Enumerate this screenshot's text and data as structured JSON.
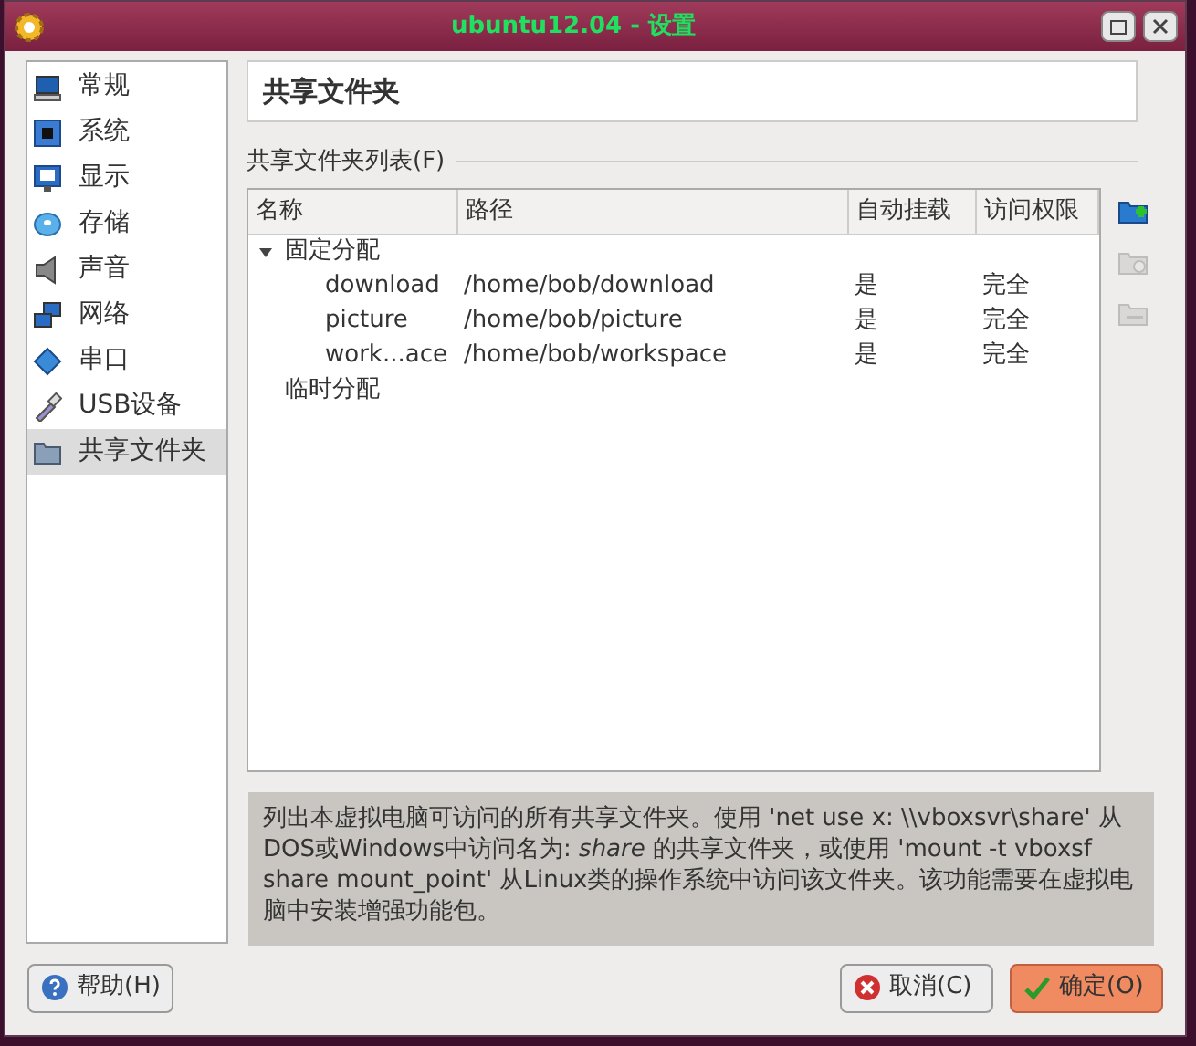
{
  "window": {
    "title": "ubuntu12.04 - 设置"
  },
  "sidebar": {
    "items": [
      {
        "label": "常规",
        "kind": "general",
        "selected": false
      },
      {
        "label": "系统",
        "kind": "system",
        "selected": false
      },
      {
        "label": "显示",
        "kind": "display",
        "selected": false
      },
      {
        "label": "存储",
        "kind": "storage",
        "selected": false
      },
      {
        "label": "声音",
        "kind": "audio",
        "selected": false
      },
      {
        "label": "网络",
        "kind": "network",
        "selected": false
      },
      {
        "label": "串口",
        "kind": "serial",
        "selected": false
      },
      {
        "label": "USB设备",
        "kind": "usb",
        "selected": false
      },
      {
        "label": "共享文件夹",
        "kind": "shared",
        "selected": true
      }
    ]
  },
  "page_title": "共享文件夹",
  "group_label": "共享文件夹列表(F)",
  "table": {
    "columns": [
      "名称",
      "路径",
      "自动挂载",
      "访问权限"
    ],
    "rows": [
      {
        "name": "固定分配",
        "expanded": true,
        "children": [
          {
            "name": "download",
            "path": "/home/bob/download",
            "automount": "是",
            "access": "完全"
          },
          {
            "name": "picture",
            "path": "/home/bob/picture",
            "automount": "是",
            "access": "完全"
          },
          {
            "name": "work...ace",
            "path": "/home/bob/workspace",
            "automount": "是",
            "access": "完全"
          }
        ]
      },
      {
        "name": "临时分配"
      }
    ]
  },
  "side_tools": [
    {
      "kind": "add",
      "disabled": false
    },
    {
      "kind": "edit",
      "disabled": true
    },
    {
      "kind": "remove",
      "disabled": true
    }
  ],
  "description": "列出本虚拟电脑可访问的所有共享文件夹。使用 'net use x: \\\\vboxsvr\\share' 从DOS或Windows中访问名为: *share* 的共享文件夹，或使用 'mount -t vboxsf share mount_point' 从Linux类的操作系统中访问该文件夹。该功能需要在虚拟电脑中安装增强功能包。",
  "buttons": {
    "help": "帮助(H)",
    "cancel": "取消(C)",
    "ok": "确定(O)"
  }
}
